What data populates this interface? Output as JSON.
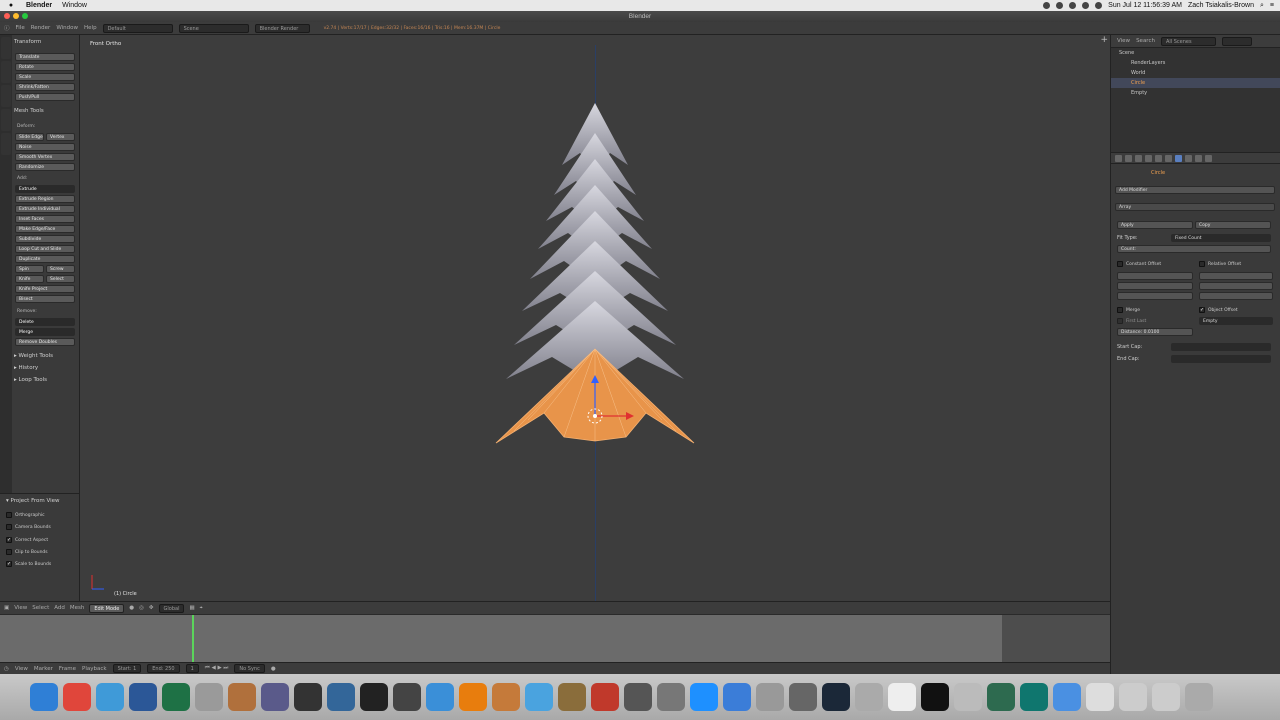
{
  "menubar": {
    "app_name": "Blender",
    "menu_window": "Window",
    "date_time": "Sun Jul 12  11:56:39 AM",
    "user": "Zach Tsiakalis-Brown"
  },
  "window": {
    "title": "Blender"
  },
  "info_header": {
    "menus": [
      "File",
      "Render",
      "Window",
      "Help"
    ],
    "layout": "Default",
    "scene": "Scene",
    "engine": "Blender Render",
    "stats": "v2.74 | Verts:17/17 | Edges:32/32 | Faces:16/16 | Tris:16 | Mem:16.37M | Circle"
  },
  "tool_shelf": {
    "transform_header": "Transform",
    "transform_buttons": [
      "Translate",
      "Rotate",
      "Scale",
      "Shrink/Fatten",
      "Push/Pull"
    ],
    "mesh_tools_header": "Mesh Tools",
    "deform_label": "Deform:",
    "slide_edge": "Slide Edge",
    "vertex": "Vertex",
    "noise": "Noise",
    "smooth_vertex": "Smooth Vertex",
    "randomize": "Randomize",
    "add_label": "Add:",
    "extrude": "Extrude",
    "add_buttons": [
      "Extrude Region",
      "Extrude Individual",
      "Inset Faces",
      "Make Edge/Face",
      "Subdivide",
      "Loop Cut and Slide",
      "Duplicate"
    ],
    "spin": "Spin",
    "screw": "Screw",
    "knife": "Knife",
    "select": "Select",
    "knife_project": "Knife Project",
    "bisect": "Bisect",
    "remove_label": "Remove:",
    "delete": "Delete",
    "merge": "Merge",
    "remove_doubles": "Remove Doubles",
    "collapsed_panels": [
      "Weight Tools",
      "History",
      "Loop Tools"
    ]
  },
  "operator_panel": {
    "title": "Project From View",
    "options": [
      {
        "label": "Orthographic",
        "checked": false
      },
      {
        "label": "Camera Bounds",
        "checked": false
      },
      {
        "label": "Correct Aspect",
        "checked": true
      },
      {
        "label": "Clip to Bounds",
        "checked": false
      },
      {
        "label": "Scale to Bounds",
        "checked": true
      }
    ]
  },
  "viewport": {
    "view_label": "Front Ortho",
    "object_label": "(1) Circle",
    "mesh_color": "#e8944a",
    "axis_color": "#2a3f66"
  },
  "viewport_header": {
    "menus": [
      "View",
      "Select",
      "Add",
      "Mesh"
    ],
    "mode": "Edit Mode",
    "orientation": "Global"
  },
  "timeline_header": {
    "menus": [
      "View",
      "Marker",
      "Frame",
      "Playback"
    ],
    "start": "Start:",
    "start_value": "1",
    "end": "End:",
    "end_value": "250",
    "current_frame": "1",
    "sync": "No Sync"
  },
  "outliner": {
    "menus": [
      "View",
      "Search"
    ],
    "filter": "All Scenes",
    "items": [
      "Scene",
      "RenderLayers",
      "World",
      "Circle",
      "Empty"
    ]
  },
  "properties": {
    "object_name": "Circle",
    "add_modifier": "Add Modifier",
    "modifier_name": "Array",
    "apply": "Apply",
    "copy": "Copy",
    "fit_type_label": "Fit Type:",
    "fit_type": "Fixed Count",
    "count": "Count:",
    "constant_offset": "Constant Offset",
    "relative_offset": "Relative Offset",
    "merge": "Merge",
    "first_last": "First Last",
    "distance": "Distance:",
    "distance_value": "0.0100",
    "object_offset": "Object Offset",
    "offset_object": "Empty",
    "start_cap": "Start Cap:",
    "end_cap": "End Cap:"
  },
  "dock": {
    "apps": [
      "finder",
      "chrome",
      "app-store",
      "word",
      "excel",
      "help",
      "photo-booth",
      "final-cut",
      "steam-alt",
      "mac-tools",
      "epic-games",
      "unity",
      "wunderlist",
      "blender",
      "archive",
      "color-picker",
      "keyboard",
      "sandwich",
      "audacity",
      "automator",
      "safari",
      "chrome-dev",
      "tape",
      "system-preferences",
      "steam",
      "help-2",
      "launchpad",
      "sonos",
      "chess",
      "github",
      "activity",
      "messages",
      "textedit",
      "documents",
      "downloads",
      "trash"
    ]
  }
}
